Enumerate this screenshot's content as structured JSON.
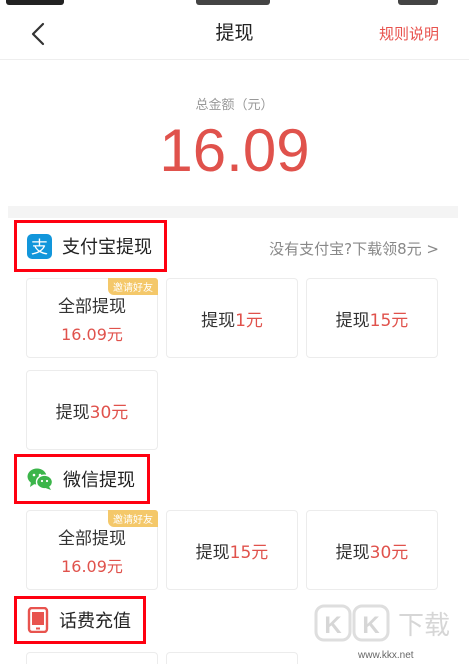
{
  "nav": {
    "title": "提现",
    "rules_label": "规则说明"
  },
  "balance": {
    "label": "总金额（元）",
    "amount": "16.09"
  },
  "sections": {
    "alipay": {
      "title": "支付宝提现",
      "promo": "没有支付宝?下载领8元 >",
      "options": [
        {
          "main": "全部提现",
          "sub": "16.09元",
          "badge": "邀请好友"
        },
        {
          "prefix": "提现",
          "amount": "1元"
        },
        {
          "prefix": "提现",
          "amount": "15元"
        },
        {
          "prefix": "提现",
          "amount": "30元"
        }
      ]
    },
    "wechat": {
      "title": "微信提现",
      "options": [
        {
          "main": "全部提现",
          "sub": "16.09元",
          "badge": "邀请好友"
        },
        {
          "prefix": "提现",
          "amount": "15元"
        },
        {
          "prefix": "提现",
          "amount": "30元"
        }
      ]
    },
    "phone": {
      "title": "话费充值"
    }
  },
  "watermark": {
    "logo": "KK下载",
    "url": "www.kkx.net"
  },
  "colors": {
    "accent": "#e0524c",
    "highlight_border": "#ff0010",
    "alipay_blue": "#1296db",
    "wechat_green": "#3bb54a",
    "phone_red": "#e8534e",
    "badge": "#f4c86a"
  },
  "icons": {
    "back": "chevron-left-icon",
    "alipay": "alipay-icon",
    "wechat": "wechat-icon",
    "phone": "phone-icon"
  }
}
